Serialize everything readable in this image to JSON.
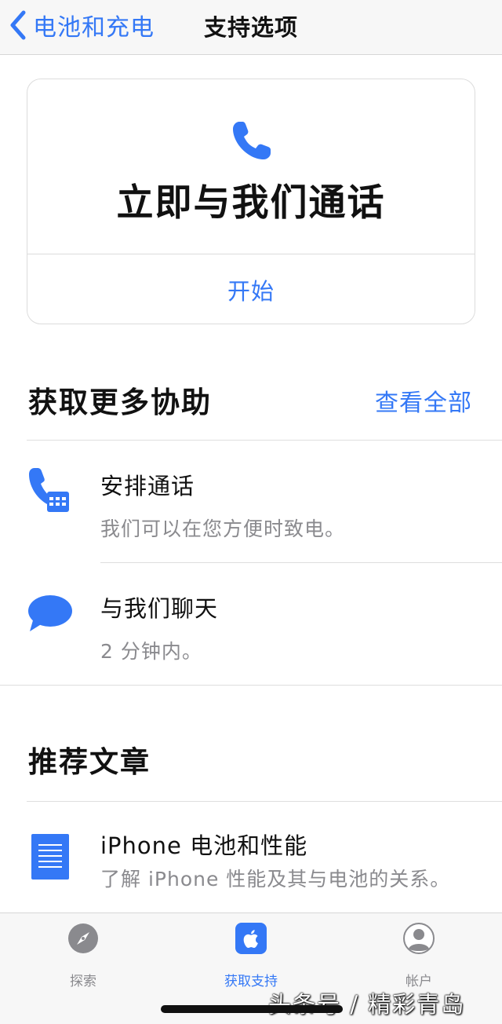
{
  "nav": {
    "back_label": "电池和充电",
    "title": "支持选项"
  },
  "call_card": {
    "icon": "phone-icon",
    "title": "立即与我们通话",
    "action_label": "开始"
  },
  "more_help": {
    "heading": "获取更多协助",
    "see_all_label": "查看全部",
    "items": [
      {
        "icon": "phone-calendar-icon",
        "title": "安排通话",
        "subtitle": "我们可以在您方便时致电。"
      },
      {
        "icon": "chat-bubble-icon",
        "title": "与我们聊天",
        "subtitle": "2 分钟内。"
      }
    ]
  },
  "articles": {
    "heading": "推荐文章",
    "items": [
      {
        "icon": "document-icon",
        "title": "iPhone 电池和性能",
        "subtitle": "了解 iPhone 性能及其与电池的关系。"
      }
    ]
  },
  "tabbar": {
    "tabs": [
      {
        "icon": "compass-icon",
        "label": "探索",
        "active": false
      },
      {
        "icon": "apple-icon",
        "label": "获取支持",
        "active": true
      },
      {
        "icon": "person-icon",
        "label": "帐户",
        "active": false
      }
    ]
  },
  "watermark": "头条号 / 精彩青岛",
  "colors": {
    "accent": "#3478f6",
    "secondary_text": "#8a8a8e",
    "separator": "#dedede"
  }
}
